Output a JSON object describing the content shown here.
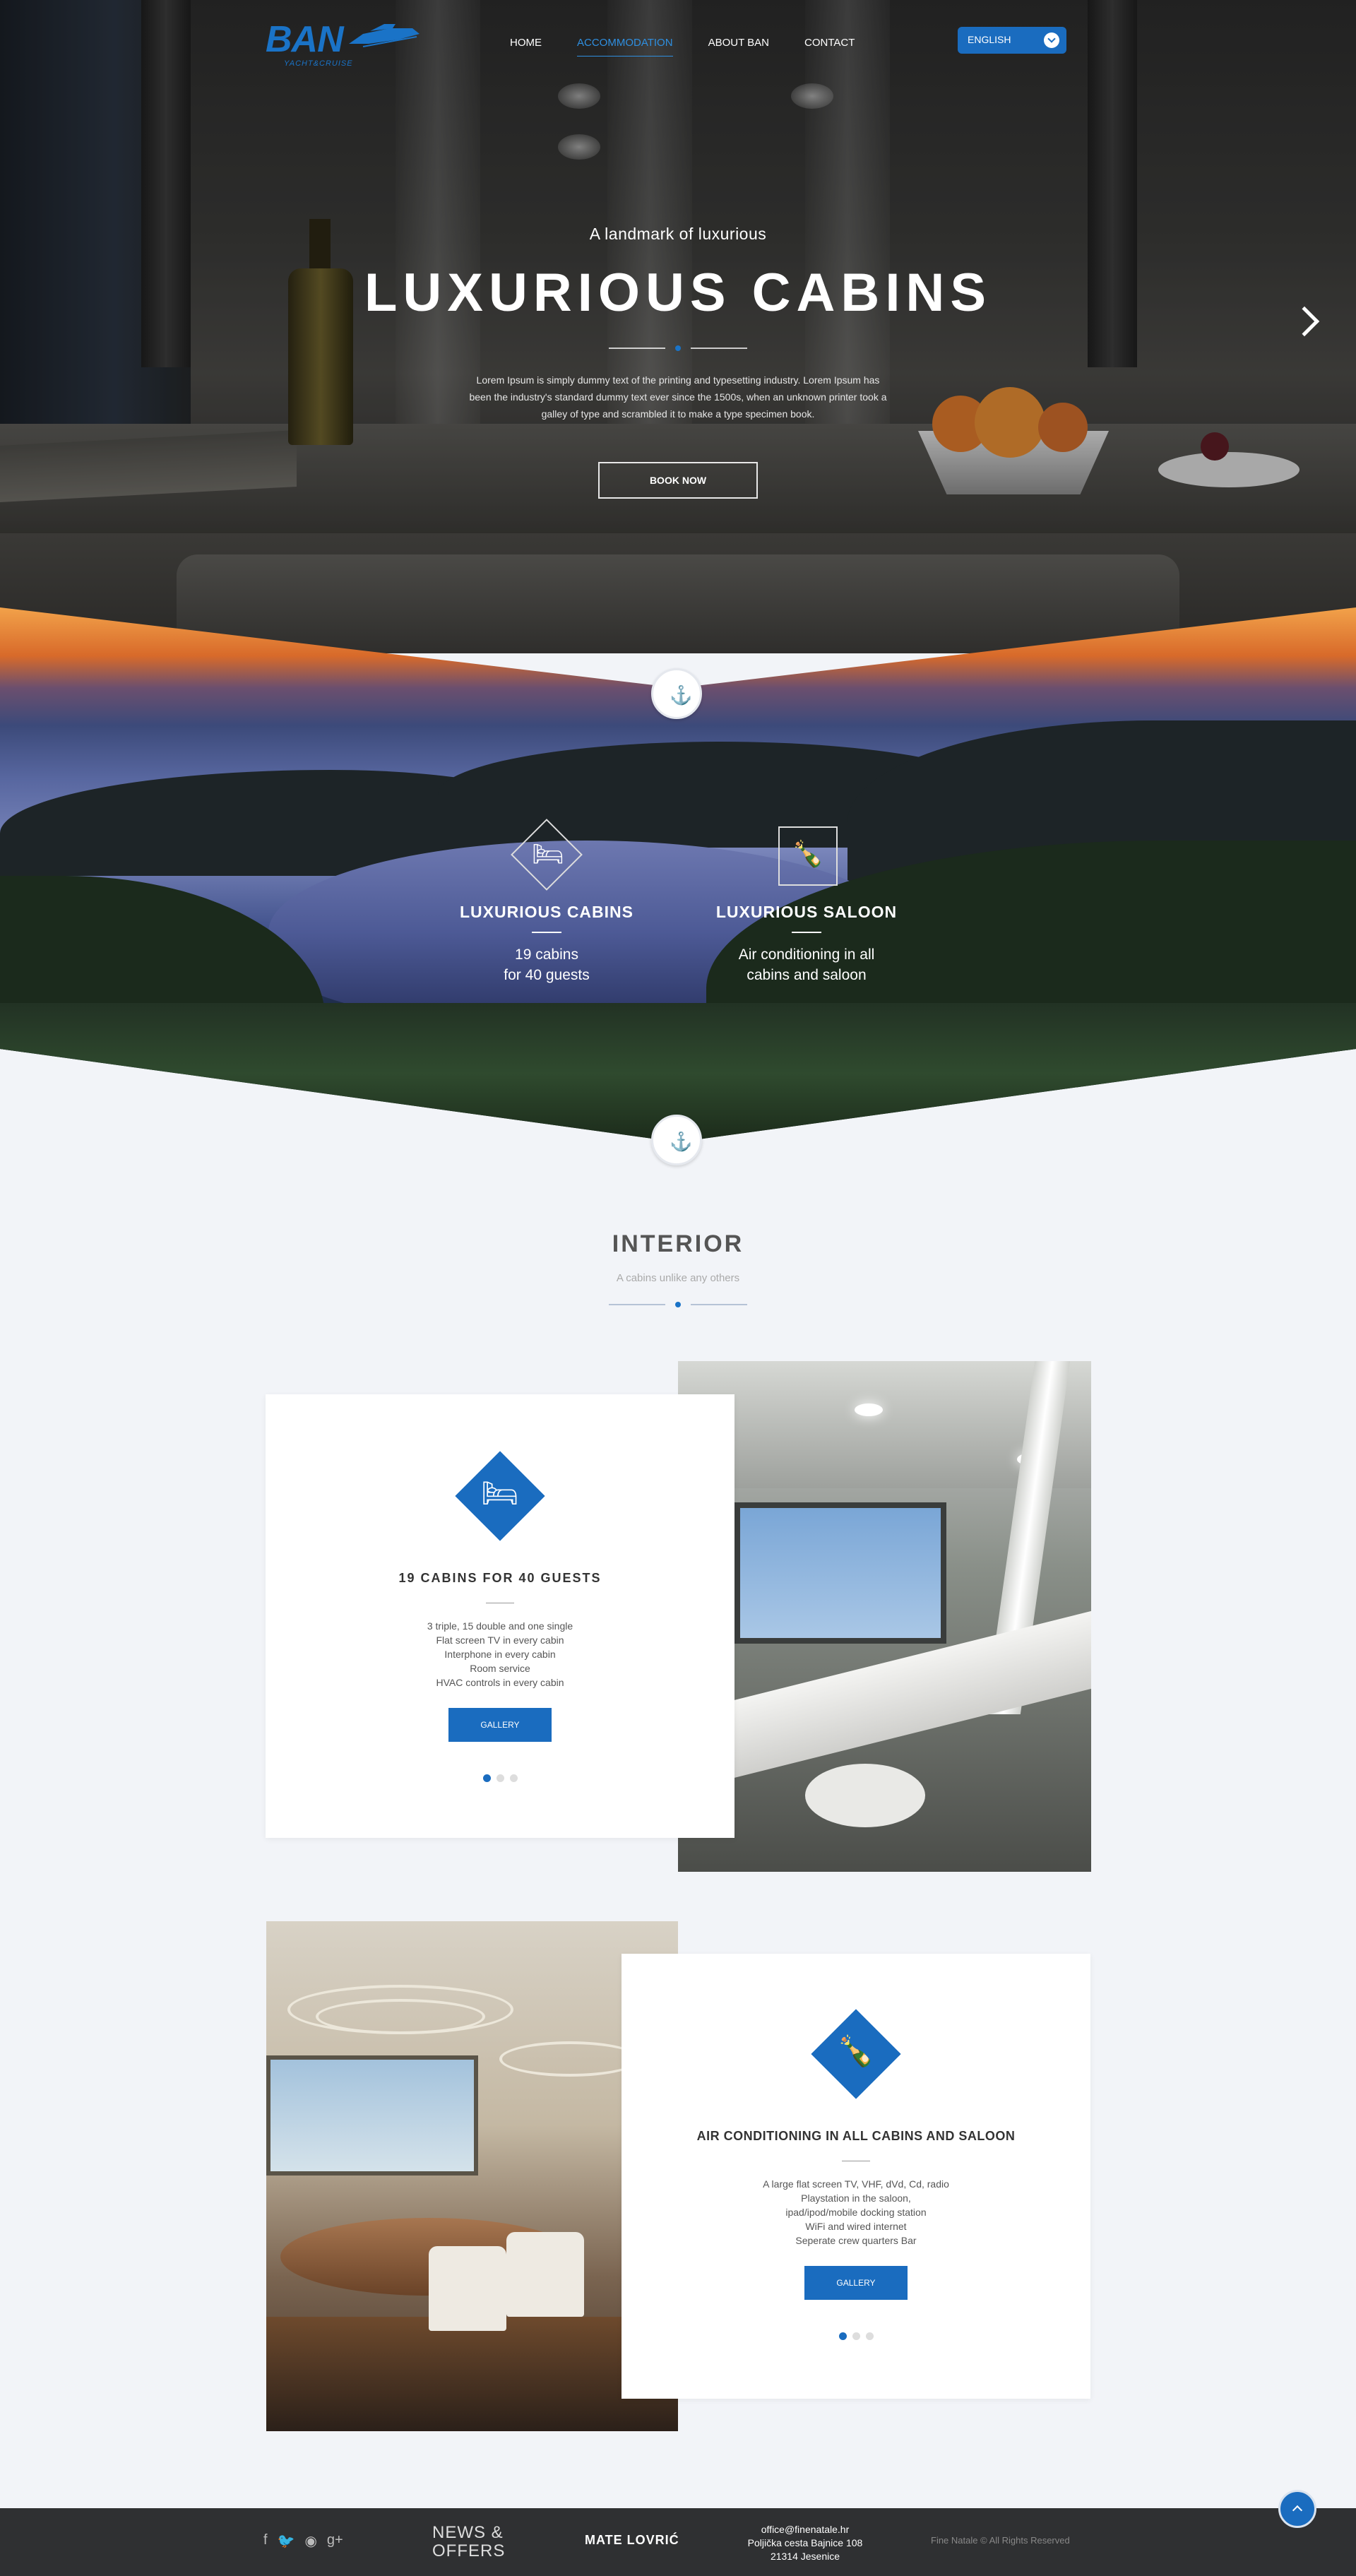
{
  "header": {
    "logo_text": "BAN",
    "logo_sub": "YACHT&CRUISE",
    "nav": [
      {
        "label": "HOME"
      },
      {
        "label": "ACCOMMODATION"
      },
      {
        "label": "ABOUT BAN"
      },
      {
        "label": "CONTACT"
      }
    ],
    "language": "ENGLISH"
  },
  "hero": {
    "kicker": "A landmark of luxurious",
    "title": "LUXURIOUS CABINS",
    "text": "Lorem Ipsum is simply dummy text of the printing and typesetting industry. Lorem Ipsum has been the industry's standard dummy text ever since the 1500s, when an unknown printer took a galley of type and scrambled it to make a type specimen book.",
    "button": "BOOK NOW"
  },
  "features": [
    {
      "title": "LUXURIOUS CABINS",
      "desc_line1": "19 cabins",
      "desc_line2": "for 40 guests",
      "icon": "bed-icon"
    },
    {
      "title": "LUXURIOUS SALOON",
      "desc_line1": "Air conditioning in all",
      "desc_line2": "cabins and saloon",
      "icon": "waiter-icon"
    }
  ],
  "interior": {
    "title": "INTERIOR",
    "subtitle": "A cabins unlike any others"
  },
  "cards": [
    {
      "title": "19 CABINS FOR 40 GUESTS",
      "items": [
        "3 triple, 15 double and one single",
        "Flat screen TV in every cabin",
        "Interphone in every cabin",
        "Room service",
        "HVAC controls in every cabin"
      ],
      "button": "GALLERY",
      "icon": "bed-icon"
    },
    {
      "title": "AIR CONDITIONING IN ALL CABINS AND SALOON",
      "items": [
        "A large flat screen TV, VHF, dVd, Cd, radio",
        "Playstation in the saloon,",
        "ipad/ipod/mobile docking station",
        "WiFi and wired internet",
        "Seperate crew quarters Bar"
      ],
      "button": "GALLERY",
      "icon": "waiter-icon"
    }
  ],
  "footer": {
    "news_line1": "NEWS &",
    "news_line2": "OFFERS",
    "name": "MATE LOVRIĆ",
    "email": "office@finenatale.hr",
    "address1": "Poljička cesta Bajnice 108",
    "address2": "21314 Jesenice",
    "copyright": "Fine Natale © All Rights Reserved"
  },
  "colors": {
    "accent": "#1a6cbf",
    "footer_bg": "#2f3032",
    "page_bg": "#f2f4f8"
  }
}
